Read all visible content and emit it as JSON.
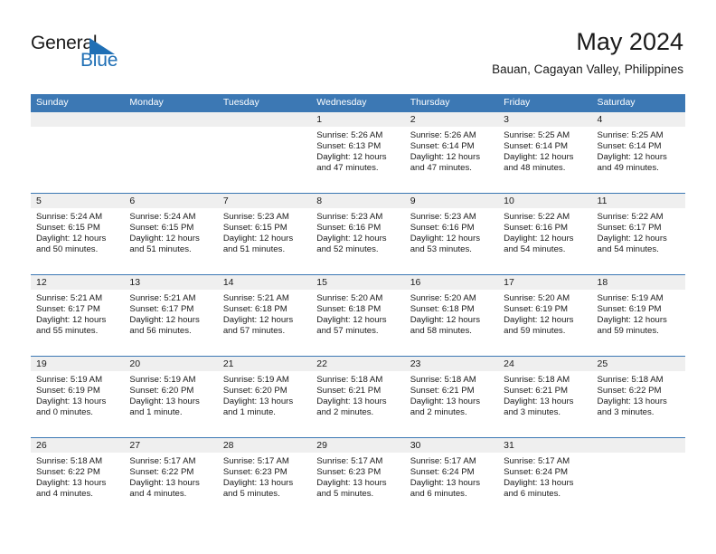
{
  "brand": {
    "name_part1": "General",
    "name_part2": "Blue",
    "triangle_icon": "triangle-icon",
    "color_blue": "#1f6fb5"
  },
  "header": {
    "title": "May 2024",
    "subtitle": "Bauan, Cagayan Valley, Philippines"
  },
  "theme": {
    "header_blue": "#3c78b4",
    "daynum_band": "#efefef",
    "text": "#1a1a1a"
  },
  "weekdays": [
    "Sunday",
    "Monday",
    "Tuesday",
    "Wednesday",
    "Thursday",
    "Friday",
    "Saturday"
  ],
  "weeks": [
    [
      {
        "day": "",
        "empty": true,
        "sunrise": "",
        "sunset": "",
        "daylight_line1": "",
        "daylight_line2": ""
      },
      {
        "day": "",
        "empty": true,
        "sunrise": "",
        "sunset": "",
        "daylight_line1": "",
        "daylight_line2": ""
      },
      {
        "day": "",
        "empty": true,
        "sunrise": "",
        "sunset": "",
        "daylight_line1": "",
        "daylight_line2": ""
      },
      {
        "day": "1",
        "empty": false,
        "sunrise": "Sunrise: 5:26 AM",
        "sunset": "Sunset: 6:13 PM",
        "daylight_line1": "Daylight: 12 hours",
        "daylight_line2": "and 47 minutes."
      },
      {
        "day": "2",
        "empty": false,
        "sunrise": "Sunrise: 5:26 AM",
        "sunset": "Sunset: 6:14 PM",
        "daylight_line1": "Daylight: 12 hours",
        "daylight_line2": "and 47 minutes."
      },
      {
        "day": "3",
        "empty": false,
        "sunrise": "Sunrise: 5:25 AM",
        "sunset": "Sunset: 6:14 PM",
        "daylight_line1": "Daylight: 12 hours",
        "daylight_line2": "and 48 minutes."
      },
      {
        "day": "4",
        "empty": false,
        "sunrise": "Sunrise: 5:25 AM",
        "sunset": "Sunset: 6:14 PM",
        "daylight_line1": "Daylight: 12 hours",
        "daylight_line2": "and 49 minutes."
      }
    ],
    [
      {
        "day": "5",
        "empty": false,
        "sunrise": "Sunrise: 5:24 AM",
        "sunset": "Sunset: 6:15 PM",
        "daylight_line1": "Daylight: 12 hours",
        "daylight_line2": "and 50 minutes."
      },
      {
        "day": "6",
        "empty": false,
        "sunrise": "Sunrise: 5:24 AM",
        "sunset": "Sunset: 6:15 PM",
        "daylight_line1": "Daylight: 12 hours",
        "daylight_line2": "and 51 minutes."
      },
      {
        "day": "7",
        "empty": false,
        "sunrise": "Sunrise: 5:23 AM",
        "sunset": "Sunset: 6:15 PM",
        "daylight_line1": "Daylight: 12 hours",
        "daylight_line2": "and 51 minutes."
      },
      {
        "day": "8",
        "empty": false,
        "sunrise": "Sunrise: 5:23 AM",
        "sunset": "Sunset: 6:16 PM",
        "daylight_line1": "Daylight: 12 hours",
        "daylight_line2": "and 52 minutes."
      },
      {
        "day": "9",
        "empty": false,
        "sunrise": "Sunrise: 5:23 AM",
        "sunset": "Sunset: 6:16 PM",
        "daylight_line1": "Daylight: 12 hours",
        "daylight_line2": "and 53 minutes."
      },
      {
        "day": "10",
        "empty": false,
        "sunrise": "Sunrise: 5:22 AM",
        "sunset": "Sunset: 6:16 PM",
        "daylight_line1": "Daylight: 12 hours",
        "daylight_line2": "and 54 minutes."
      },
      {
        "day": "11",
        "empty": false,
        "sunrise": "Sunrise: 5:22 AM",
        "sunset": "Sunset: 6:17 PM",
        "daylight_line1": "Daylight: 12 hours",
        "daylight_line2": "and 54 minutes."
      }
    ],
    [
      {
        "day": "12",
        "empty": false,
        "sunrise": "Sunrise: 5:21 AM",
        "sunset": "Sunset: 6:17 PM",
        "daylight_line1": "Daylight: 12 hours",
        "daylight_line2": "and 55 minutes."
      },
      {
        "day": "13",
        "empty": false,
        "sunrise": "Sunrise: 5:21 AM",
        "sunset": "Sunset: 6:17 PM",
        "daylight_line1": "Daylight: 12 hours",
        "daylight_line2": "and 56 minutes."
      },
      {
        "day": "14",
        "empty": false,
        "sunrise": "Sunrise: 5:21 AM",
        "sunset": "Sunset: 6:18 PM",
        "daylight_line1": "Daylight: 12 hours",
        "daylight_line2": "and 57 minutes."
      },
      {
        "day": "15",
        "empty": false,
        "sunrise": "Sunrise: 5:20 AM",
        "sunset": "Sunset: 6:18 PM",
        "daylight_line1": "Daylight: 12 hours",
        "daylight_line2": "and 57 minutes."
      },
      {
        "day": "16",
        "empty": false,
        "sunrise": "Sunrise: 5:20 AM",
        "sunset": "Sunset: 6:18 PM",
        "daylight_line1": "Daylight: 12 hours",
        "daylight_line2": "and 58 minutes."
      },
      {
        "day": "17",
        "empty": false,
        "sunrise": "Sunrise: 5:20 AM",
        "sunset": "Sunset: 6:19 PM",
        "daylight_line1": "Daylight: 12 hours",
        "daylight_line2": "and 59 minutes."
      },
      {
        "day": "18",
        "empty": false,
        "sunrise": "Sunrise: 5:19 AM",
        "sunset": "Sunset: 6:19 PM",
        "daylight_line1": "Daylight: 12 hours",
        "daylight_line2": "and 59 minutes."
      }
    ],
    [
      {
        "day": "19",
        "empty": false,
        "sunrise": "Sunrise: 5:19 AM",
        "sunset": "Sunset: 6:19 PM",
        "daylight_line1": "Daylight: 13 hours",
        "daylight_line2": "and 0 minutes."
      },
      {
        "day": "20",
        "empty": false,
        "sunrise": "Sunrise: 5:19 AM",
        "sunset": "Sunset: 6:20 PM",
        "daylight_line1": "Daylight: 13 hours",
        "daylight_line2": "and 1 minute."
      },
      {
        "day": "21",
        "empty": false,
        "sunrise": "Sunrise: 5:19 AM",
        "sunset": "Sunset: 6:20 PM",
        "daylight_line1": "Daylight: 13 hours",
        "daylight_line2": "and 1 minute."
      },
      {
        "day": "22",
        "empty": false,
        "sunrise": "Sunrise: 5:18 AM",
        "sunset": "Sunset: 6:21 PM",
        "daylight_line1": "Daylight: 13 hours",
        "daylight_line2": "and 2 minutes."
      },
      {
        "day": "23",
        "empty": false,
        "sunrise": "Sunrise: 5:18 AM",
        "sunset": "Sunset: 6:21 PM",
        "daylight_line1": "Daylight: 13 hours",
        "daylight_line2": "and 2 minutes."
      },
      {
        "day": "24",
        "empty": false,
        "sunrise": "Sunrise: 5:18 AM",
        "sunset": "Sunset: 6:21 PM",
        "daylight_line1": "Daylight: 13 hours",
        "daylight_line2": "and 3 minutes."
      },
      {
        "day": "25",
        "empty": false,
        "sunrise": "Sunrise: 5:18 AM",
        "sunset": "Sunset: 6:22 PM",
        "daylight_line1": "Daylight: 13 hours",
        "daylight_line2": "and 3 minutes."
      }
    ],
    [
      {
        "day": "26",
        "empty": false,
        "sunrise": "Sunrise: 5:18 AM",
        "sunset": "Sunset: 6:22 PM",
        "daylight_line1": "Daylight: 13 hours",
        "daylight_line2": "and 4 minutes."
      },
      {
        "day": "27",
        "empty": false,
        "sunrise": "Sunrise: 5:17 AM",
        "sunset": "Sunset: 6:22 PM",
        "daylight_line1": "Daylight: 13 hours",
        "daylight_line2": "and 4 minutes."
      },
      {
        "day": "28",
        "empty": false,
        "sunrise": "Sunrise: 5:17 AM",
        "sunset": "Sunset: 6:23 PM",
        "daylight_line1": "Daylight: 13 hours",
        "daylight_line2": "and 5 minutes."
      },
      {
        "day": "29",
        "empty": false,
        "sunrise": "Sunrise: 5:17 AM",
        "sunset": "Sunset: 6:23 PM",
        "daylight_line1": "Daylight: 13 hours",
        "daylight_line2": "and 5 minutes."
      },
      {
        "day": "30",
        "empty": false,
        "sunrise": "Sunrise: 5:17 AM",
        "sunset": "Sunset: 6:24 PM",
        "daylight_line1": "Daylight: 13 hours",
        "daylight_line2": "and 6 minutes."
      },
      {
        "day": "31",
        "empty": false,
        "sunrise": "Sunrise: 5:17 AM",
        "sunset": "Sunset: 6:24 PM",
        "daylight_line1": "Daylight: 13 hours",
        "daylight_line2": "and 6 minutes."
      },
      {
        "day": "",
        "empty": true,
        "sunrise": "",
        "sunset": "",
        "daylight_line1": "",
        "daylight_line2": ""
      }
    ]
  ]
}
